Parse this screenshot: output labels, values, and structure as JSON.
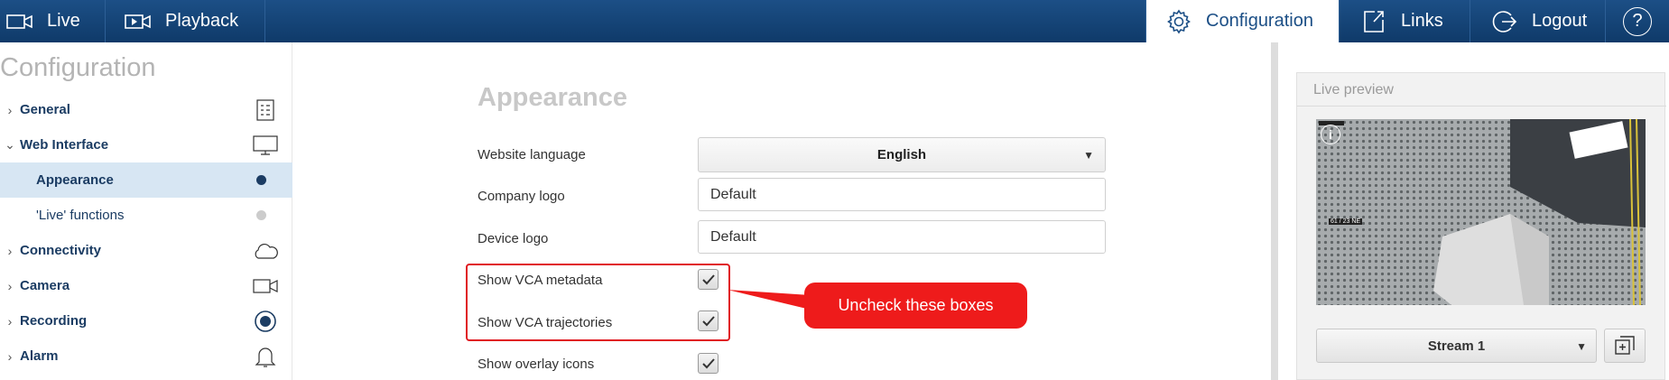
{
  "topbar": {
    "live": "Live",
    "playback": "Playback",
    "configuration": "Configuration",
    "links": "Links",
    "logout": "Logout",
    "help": "?"
  },
  "sidebar": {
    "title": "Configuration",
    "items": [
      {
        "label": "General",
        "icon": "document-list-icon"
      },
      {
        "label": "Web Interface",
        "icon": "monitor-icon"
      },
      {
        "label": "Appearance",
        "icon": "dot-filled-icon"
      },
      {
        "label": "'Live' functions",
        "icon": "dot-gray-icon"
      },
      {
        "label": "Connectivity",
        "icon": "cloud-icon"
      },
      {
        "label": "Camera",
        "icon": "video-camera-icon"
      },
      {
        "label": "Recording",
        "icon": "record-icon"
      },
      {
        "label": "Alarm",
        "icon": "bell-icon"
      }
    ]
  },
  "main": {
    "title": "Appearance",
    "website_language": {
      "label": "Website language",
      "value": "English"
    },
    "company_logo": {
      "label": "Company logo",
      "value": "Default"
    },
    "device_logo": {
      "label": "Device logo",
      "value": "Default"
    },
    "show_vca_metadata": {
      "label": "Show VCA metadata",
      "checked": true
    },
    "show_vca_trajectories": {
      "label": "Show VCA trajectories",
      "checked": true
    },
    "show_overlay_icons": {
      "label": "Show overlay icons",
      "checked": true
    },
    "callout": "Uncheck these boxes"
  },
  "preview": {
    "title": "Live preview",
    "stream": "Stream 1",
    "camera_overlay_text": "61 / 23 NE"
  },
  "colors": {
    "topbar": "#1c4f86",
    "accent_red": "#ee1b1b",
    "selected_bg": "#d7e6f3",
    "nav_text": "#1b3c63"
  }
}
